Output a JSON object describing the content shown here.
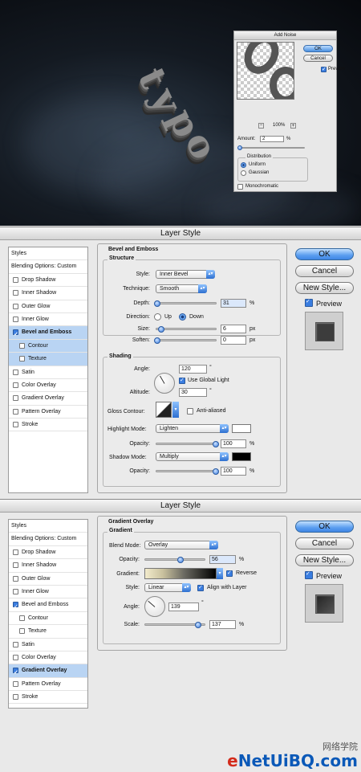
{
  "noise_dialog": {
    "title": "Add Noise",
    "ok": "OK",
    "cancel": "Cancel",
    "preview": "Preview",
    "zoom": "100%",
    "amount_label": "Amount:",
    "amount_value": "2",
    "amount_unit": "%",
    "distribution_label": "Distribution",
    "uniform": "Uniform",
    "gaussian": "Gaussian",
    "monochromatic": "Monochromatic"
  },
  "canvas_text": "typo",
  "bevel_dialog": {
    "title": "Layer Style",
    "styles": [
      "Styles",
      "Blending Options: Custom",
      "Drop Shadow",
      "Inner Shadow",
      "Outer Glow",
      "Inner Glow",
      "Bevel and Emboss",
      "Contour",
      "Texture",
      "Satin",
      "Color Overlay",
      "Gradient Overlay",
      "Pattern Overlay",
      "Stroke"
    ],
    "section": "Bevel and Emboss",
    "structure": "Structure",
    "style_label": "Style:",
    "style_value": "Inner Bevel",
    "technique_label": "Technique:",
    "technique_value": "Smooth",
    "depth_label": "Depth:",
    "depth_value": "31",
    "depth_unit": "%",
    "direction_label": "Direction:",
    "up": "Up",
    "down": "Down",
    "size_label": "Size:",
    "size_value": "6",
    "size_unit": "px",
    "soften_label": "Soften:",
    "soften_value": "0",
    "soften_unit": "px",
    "shading": "Shading",
    "angle_label": "Angle:",
    "angle_value": "120",
    "deg": "°",
    "global_light": "Use Global Light",
    "altitude_label": "Altitude:",
    "altitude_value": "30",
    "gloss_label": "Gloss Contour:",
    "anti_aliased": "Anti-aliased",
    "highlight_label": "Highlight Mode:",
    "highlight_value": "Lighten",
    "opacity_label": "Opacity:",
    "opacity1_value": "100",
    "pct": "%",
    "shadow_label": "Shadow Mode:",
    "shadow_value": "Multiply",
    "opacity2_value": "100",
    "ok": "OK",
    "cancel": "Cancel",
    "new_style": "New Style...",
    "preview": "Preview"
  },
  "gradient_dialog": {
    "title": "Layer Style",
    "section": "Gradient Overlay",
    "sub": "Gradient",
    "blend_label": "Blend Mode:",
    "blend_value": "Overlay",
    "opacity_label": "Opacity:",
    "opacity_value": "56",
    "pct": "%",
    "gradient_label": "Gradient:",
    "reverse": "Reverse",
    "style_label": "Style:",
    "style_value": "Linear",
    "align": "Align with Layer",
    "angle_label": "Angle:",
    "angle_value": "139",
    "deg": "°",
    "scale_label": "Scale:",
    "scale_value": "137",
    "ok": "OK",
    "cancel": "Cancel",
    "new_style": "New Style...",
    "preview": "Preview"
  },
  "watermark": {
    "cn": "网络学院",
    "text_e": "e",
    "text_rest": "NetUiBQ.com"
  },
  "colors": {
    "highlight_swatch": "#ffffff",
    "shadow_swatch": "#000000",
    "accent": "#3a7de0"
  }
}
